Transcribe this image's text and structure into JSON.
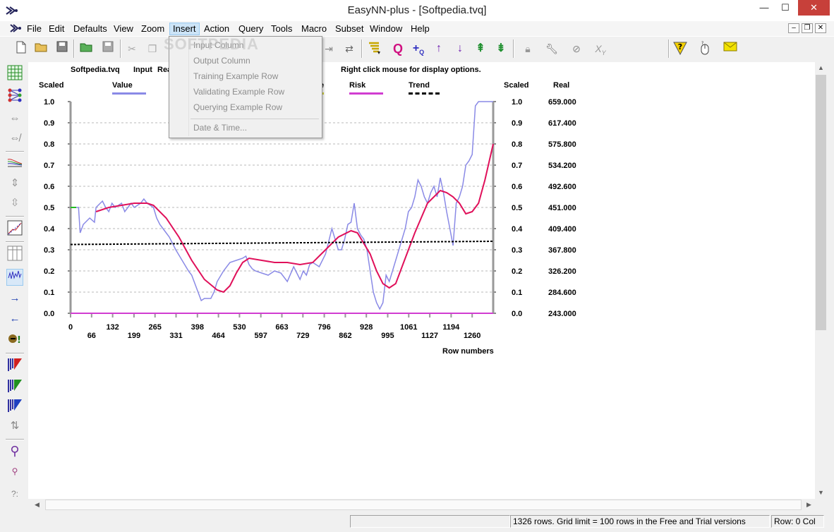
{
  "window": {
    "title": "EasyNN-plus - [Softpedia.tvq]",
    "min": "—",
    "max": "☐",
    "close": "✕"
  },
  "menu": [
    "File",
    "Edit",
    "Defaults",
    "View",
    "Zoom",
    "Insert",
    "Action",
    "Query",
    "Tools",
    "Macro",
    "Subset",
    "Window",
    "Help"
  ],
  "active_menu": "Insert",
  "insert_menu": {
    "items": [
      "Input Column",
      "Output Column",
      "Training Example Row",
      "Validating Example Row",
      "Querying Example Row",
      "Date & Time..."
    ],
    "disabled": true
  },
  "watermark": "SOFTPEDIA",
  "graph": {
    "file": "Softpedia.tvq",
    "column_label": "Input",
    "column_name_prefix": "Rea",
    "hint": "Right click mouse for display options.",
    "left_scale_header": "Scaled",
    "right_scale_header": "Scaled",
    "real_header": "Real",
    "legend_obscured_char": "e",
    "x_axis_label": "Row numbers"
  },
  "status": {
    "message": "1326 rows. Grid limit = 100 rows in the Free and Trial versions",
    "position": "Row: 0  Col"
  },
  "colors": {
    "value": "#8a8ae6",
    "risk": "#d13dd1",
    "trend": "#000000",
    "smoothed": "#e0105a",
    "start_marker": "#22bb22"
  },
  "chart_data": {
    "type": "line",
    "x_label": "Row numbers",
    "xlim": [
      0,
      1326
    ],
    "ylim": [
      0.0,
      1.0
    ],
    "x_ticks_top": [
      "0",
      "132",
      "265",
      "398",
      "530",
      "663",
      "796",
      "928",
      "1061",
      "1194"
    ],
    "x_ticks_bottom": [
      "66",
      "199",
      "331",
      "464",
      "597",
      "729",
      "862",
      "995",
      "1127",
      "1260"
    ],
    "y_ticks_scaled": [
      "1.0",
      "0.9",
      "0.8",
      "0.7",
      "0.6",
      "0.5",
      "0.4",
      "0.3",
      "0.2",
      "0.1",
      "0.0"
    ],
    "y_ticks_real": [
      "659.000",
      "617.400",
      "575.800",
      "534.200",
      "492.600",
      "451.000",
      "409.400",
      "367.800",
      "326.200",
      "284.600",
      "243.000"
    ],
    "legend": [
      "Value",
      "Risk",
      "Trend"
    ],
    "series": [
      {
        "name": "Value",
        "x": [
          0,
          25,
          30,
          40,
          60,
          75,
          80,
          100,
          110,
          120,
          130,
          140,
          150,
          160,
          170,
          180,
          190,
          200,
          220,
          230,
          240,
          260,
          270,
          280,
          290,
          300,
          310,
          330,
          350,
          370,
          380,
          390,
          400,
          410,
          420,
          440,
          450,
          460,
          480,
          500,
          520,
          540,
          550,
          560,
          570,
          580,
          600,
          620,
          640,
          660,
          680,
          700,
          720,
          730,
          740,
          750,
          760,
          780,
          800,
          820,
          830,
          840,
          850,
          860,
          870,
          880,
          890,
          900,
          910,
          920,
          930,
          940,
          950,
          960,
          970,
          980,
          990,
          1000,
          1010,
          1020,
          1030,
          1040,
          1050,
          1060,
          1070,
          1080,
          1090,
          1100,
          1110,
          1120,
          1130,
          1140,
          1150,
          1160,
          1170,
          1180,
          1190,
          1200,
          1210,
          1220,
          1230,
          1240,
          1250,
          1260,
          1270,
          1280,
          1290,
          1300,
          1310,
          1326
        ],
        "y": [
          0.5,
          0.5,
          0.38,
          0.42,
          0.45,
          0.43,
          0.5,
          0.53,
          0.5,
          0.48,
          0.52,
          0.5,
          0.51,
          0.52,
          0.48,
          0.5,
          0.52,
          0.5,
          0.52,
          0.54,
          0.52,
          0.5,
          0.45,
          0.42,
          0.4,
          0.38,
          0.36,
          0.3,
          0.25,
          0.2,
          0.18,
          0.14,
          0.1,
          0.06,
          0.07,
          0.07,
          0.1,
          0.15,
          0.2,
          0.24,
          0.25,
          0.26,
          0.27,
          0.23,
          0.21,
          0.2,
          0.19,
          0.18,
          0.2,
          0.19,
          0.15,
          0.22,
          0.16,
          0.2,
          0.18,
          0.23,
          0.24,
          0.22,
          0.28,
          0.4,
          0.35,
          0.3,
          0.3,
          0.35,
          0.42,
          0.43,
          0.52,
          0.4,
          0.37,
          0.35,
          0.3,
          0.2,
          0.1,
          0.05,
          0.02,
          0.05,
          0.18,
          0.15,
          0.2,
          0.25,
          0.3,
          0.35,
          0.4,
          0.48,
          0.5,
          0.55,
          0.63,
          0.6,
          0.55,
          0.52,
          0.57,
          0.6,
          0.55,
          0.64,
          0.57,
          0.48,
          0.4,
          0.32,
          0.52,
          0.55,
          0.6,
          0.7,
          0.72,
          0.75,
          0.98,
          1.0,
          1.0,
          1.0,
          1.0,
          1.0
        ]
      },
      {
        "name": "",
        "x": [
          80,
          120,
          160,
          200,
          240,
          260,
          300,
          340,
          380,
          420,
          460,
          480,
          500,
          520,
          540,
          560,
          600,
          640,
          680,
          720,
          760,
          800,
          840,
          880,
          900,
          940,
          960,
          980,
          1000,
          1020,
          1040,
          1080,
          1120,
          1160,
          1180,
          1200,
          1220,
          1240,
          1260,
          1280,
          1300,
          1326
        ],
        "y": [
          0.48,
          0.5,
          0.51,
          0.52,
          0.52,
          0.51,
          0.45,
          0.36,
          0.25,
          0.16,
          0.11,
          0.1,
          0.13,
          0.19,
          0.24,
          0.26,
          0.25,
          0.24,
          0.24,
          0.23,
          0.24,
          0.3,
          0.36,
          0.39,
          0.38,
          0.28,
          0.2,
          0.14,
          0.12,
          0.14,
          0.22,
          0.38,
          0.52,
          0.58,
          0.57,
          0.55,
          0.52,
          0.47,
          0.48,
          0.52,
          0.63,
          0.8
        ]
      },
      {
        "name": "Risk",
        "x": [
          0,
          1326
        ],
        "y": [
          0.0,
          0.0
        ]
      },
      {
        "name": "Trend",
        "x": [
          0,
          1326
        ],
        "y": [
          0.325,
          0.34
        ]
      }
    ]
  }
}
